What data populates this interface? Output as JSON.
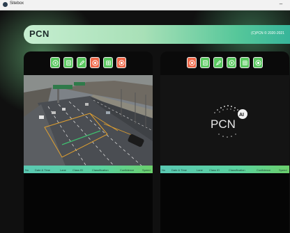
{
  "window": {
    "title": "Sitebox",
    "minimize": "–"
  },
  "header": {
    "logo": "PCN",
    "copyright": "(C)PCN © 2020-2021"
  },
  "left_panel": {
    "toolbar_icons": [
      "play-icon",
      "document-icon",
      "edit-icon",
      "stop-icon",
      "grid-icon",
      "record-icon"
    ],
    "table_columns": [
      "No",
      "Date & Time",
      "Lane",
      "Class ID",
      "Classification",
      "Confidence",
      "Speed"
    ]
  },
  "right_panel": {
    "toolbar_icons": [
      "stop-icon",
      "document-icon",
      "edit-icon",
      "play-icon",
      "grid-icon",
      "record-icon"
    ],
    "logo_text": "PCN",
    "logo_badge": "AI",
    "table_columns": [
      "No",
      "Date & Time",
      "Lane",
      "Class ID",
      "Classification",
      "Confidence",
      "Speed"
    ]
  },
  "colors": {
    "green": "#59c85f",
    "orange": "#f0694a",
    "accent": "#56c79a"
  }
}
